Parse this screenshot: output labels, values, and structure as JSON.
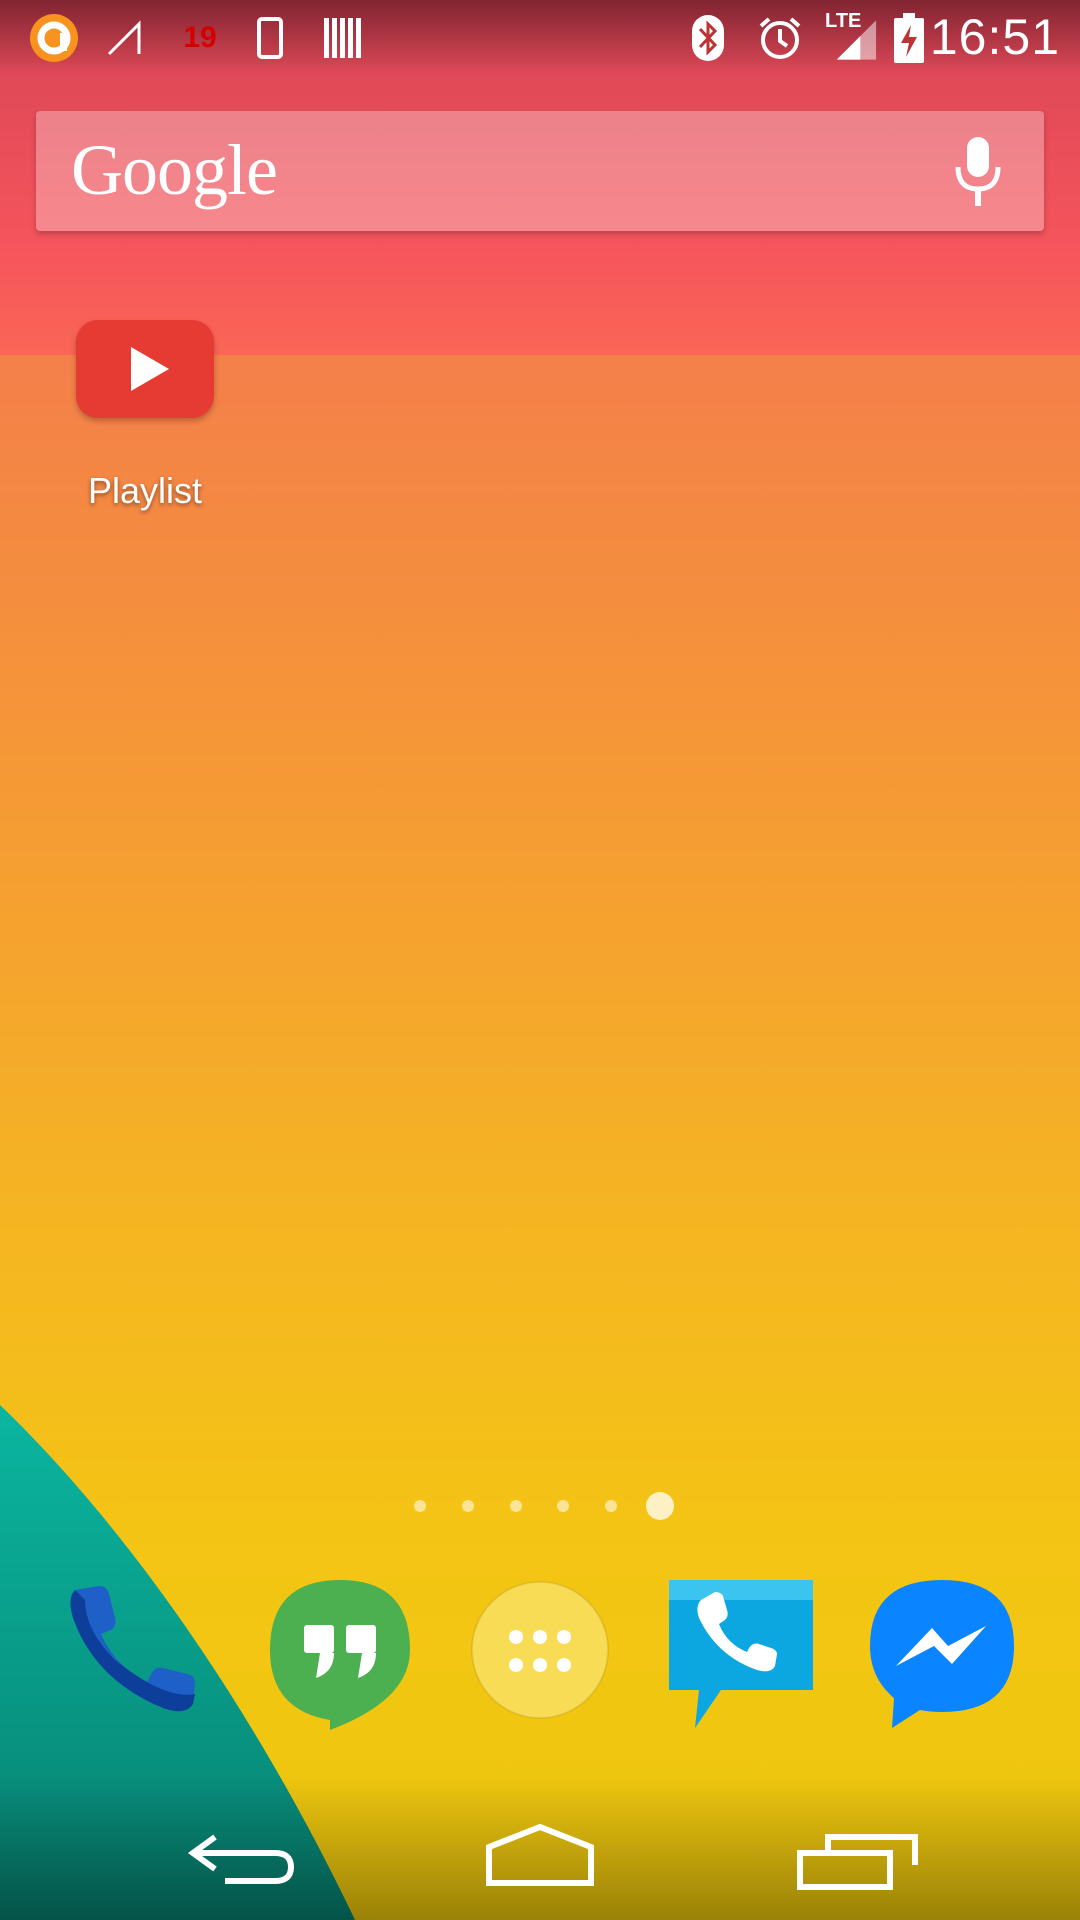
{
  "status_bar": {
    "time": "16:51",
    "weather_temp": "19",
    "network_label": "LTE",
    "icons": [
      "launcher-app-icon",
      "signal-off-icon",
      "temperature-notification-icon",
      "phone-icon",
      "barcode-icon",
      "bluetooth-icon",
      "alarm-icon",
      "lte-signal-icon",
      "battery-charging-icon"
    ]
  },
  "search_bar": {
    "logo_text": "Google",
    "voice_icon": "mic-icon"
  },
  "home": {
    "apps": [
      {
        "label": "Playlist",
        "icon": "youtube-play-icon"
      }
    ],
    "page_count": 6,
    "current_page": 6
  },
  "dock": [
    "phone-app-icon",
    "hangouts-app-icon",
    "app-drawer-icon",
    "voip-phone-app-icon",
    "messenger-app-icon"
  ],
  "nav_bar": [
    "back-icon",
    "home-icon",
    "recents-icon"
  ],
  "colors": {
    "youtube_red": "#e53b33",
    "hangouts_green": "#4caf50",
    "messenger_blue": "#0a84ff",
    "teal_wallpaper": "#0aa596"
  }
}
